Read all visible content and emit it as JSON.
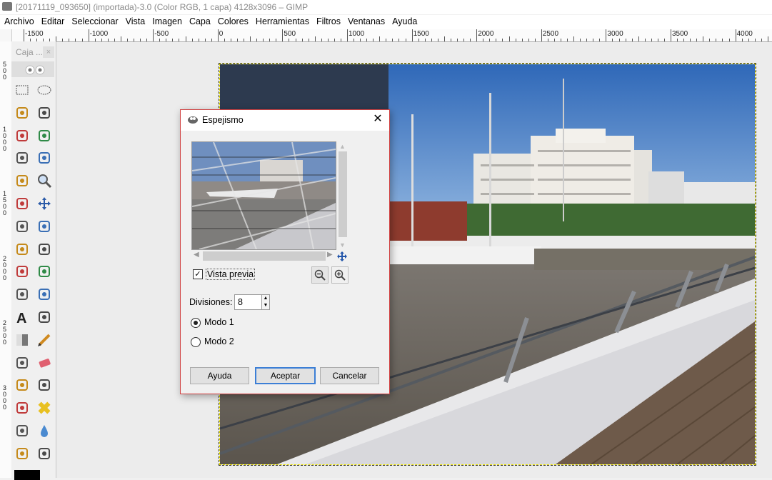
{
  "window": {
    "title": "[20171119_093650] (importada)-3.0 (Color RGB, 1 capa) 4128x3096 – GIMP"
  },
  "menu": [
    "Archivo",
    "Editar",
    "Seleccionar",
    "Vista",
    "Imagen",
    "Capa",
    "Colores",
    "Herramientas",
    "Filtros",
    "Ventanas",
    "Ayuda"
  ],
  "ruler": {
    "h_labels": [
      "-1500",
      "-1000",
      "-500",
      "0",
      "500",
      "1000",
      "1500",
      "2000",
      "2500",
      "3000",
      "3500",
      "4000"
    ],
    "v_labels": [
      "500",
      "1000",
      "1500",
      "2000",
      "2500",
      "3000"
    ]
  },
  "toolbox": {
    "title": "Caja ...",
    "close": "×",
    "tools": [
      "rect-select",
      "ellipse-select",
      "free-select",
      "fuzzy-select",
      "select-by-color",
      "scissors",
      "foreground-select",
      "paths",
      "color-picker",
      "zoom",
      "measure",
      "move",
      "align",
      "crop",
      "rotate",
      "scale",
      "shear",
      "perspective",
      "flip",
      "cage",
      "text",
      "bucket-fill",
      "blend",
      "pencil",
      "paintbrush",
      "eraser",
      "airbrush",
      "ink",
      "clone",
      "heal",
      "perspective-clone",
      "blur",
      "smudge",
      "dodge-burn"
    ]
  },
  "dialog": {
    "title": "Espejismo",
    "close": "✕",
    "preview_label": "Vista previa",
    "preview_checked": true,
    "divisions_label": "Divisiones:",
    "divisions_value": "8",
    "mode1": "Modo 1",
    "mode2": "Modo 2",
    "selected_mode": 1,
    "buttons": {
      "help": "Ayuda",
      "ok": "Aceptar",
      "cancel": "Cancelar"
    }
  }
}
